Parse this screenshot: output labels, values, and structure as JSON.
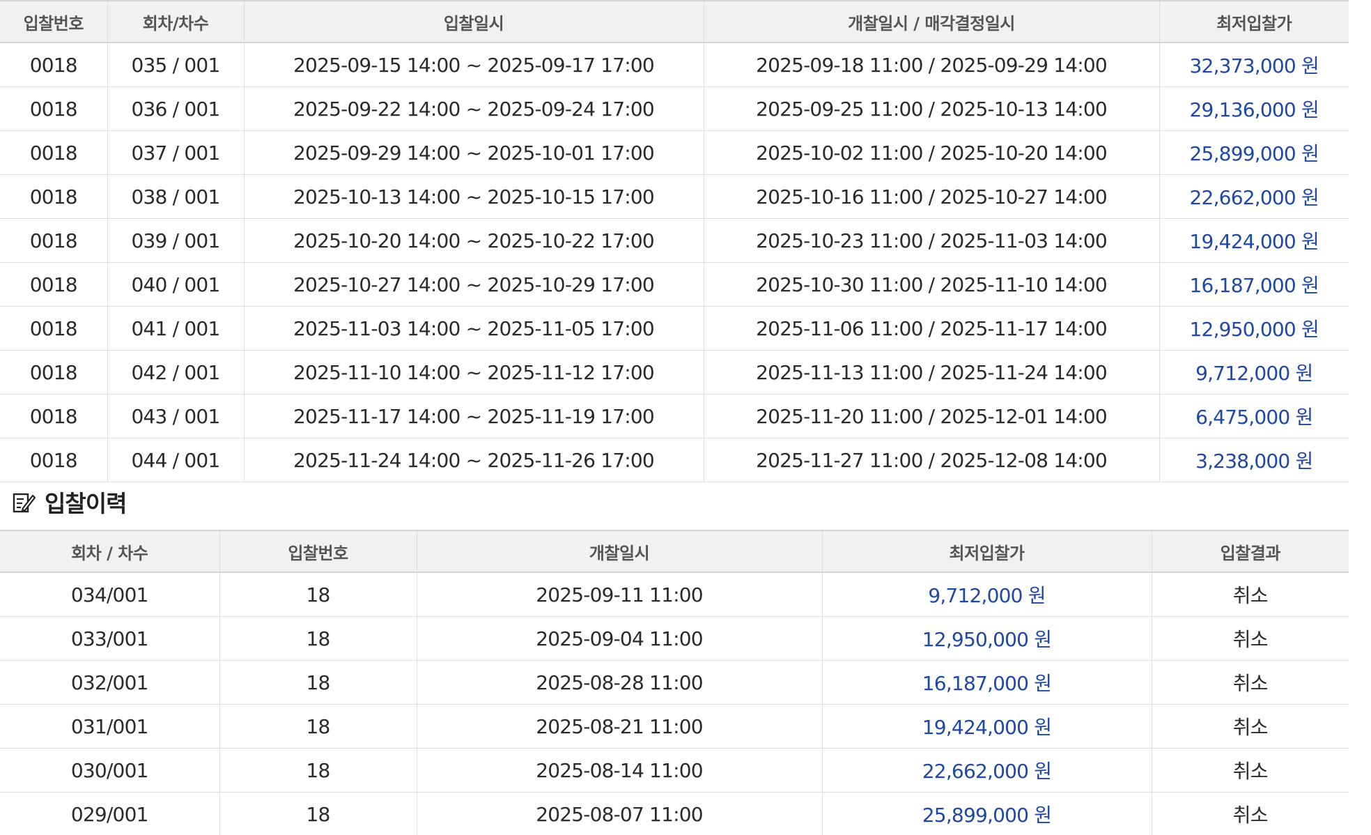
{
  "schedule": {
    "headers": [
      "입찰번호",
      "회차/차수",
      "입찰일시",
      "개찰일시 / 매각결정일시",
      "최저입찰가"
    ],
    "rows": [
      {
        "bid_no": "0018",
        "round": "035 / 001",
        "bid_period": "2025-09-15 14:00 ~ 2025-09-17 17:00",
        "open_decision": "2025-09-18 11:00 / 2025-09-29 14:00",
        "min_price": "32,373,000 원"
      },
      {
        "bid_no": "0018",
        "round": "036 / 001",
        "bid_period": "2025-09-22 14:00 ~ 2025-09-24 17:00",
        "open_decision": "2025-09-25 11:00 / 2025-10-13 14:00",
        "min_price": "29,136,000 원"
      },
      {
        "bid_no": "0018",
        "round": "037 / 001",
        "bid_period": "2025-09-29 14:00 ~ 2025-10-01 17:00",
        "open_decision": "2025-10-02 11:00 / 2025-10-20 14:00",
        "min_price": "25,899,000 원"
      },
      {
        "bid_no": "0018",
        "round": "038 / 001",
        "bid_period": "2025-10-13 14:00 ~ 2025-10-15 17:00",
        "open_decision": "2025-10-16 11:00 / 2025-10-27 14:00",
        "min_price": "22,662,000 원"
      },
      {
        "bid_no": "0018",
        "round": "039 / 001",
        "bid_period": "2025-10-20 14:00 ~ 2025-10-22 17:00",
        "open_decision": "2025-10-23 11:00 / 2025-11-03 14:00",
        "min_price": "19,424,000 원"
      },
      {
        "bid_no": "0018",
        "round": "040 / 001",
        "bid_period": "2025-10-27 14:00 ~ 2025-10-29 17:00",
        "open_decision": "2025-10-30 11:00 / 2025-11-10 14:00",
        "min_price": "16,187,000 원"
      },
      {
        "bid_no": "0018",
        "round": "041 / 001",
        "bid_period": "2025-11-03 14:00 ~ 2025-11-05 17:00",
        "open_decision": "2025-11-06 11:00 / 2025-11-17 14:00",
        "min_price": "12,950,000 원"
      },
      {
        "bid_no": "0018",
        "round": "042 / 001",
        "bid_period": "2025-11-10 14:00 ~ 2025-11-12 17:00",
        "open_decision": "2025-11-13 11:00 / 2025-11-24 14:00",
        "min_price": "9,712,000 원"
      },
      {
        "bid_no": "0018",
        "round": "043 / 001",
        "bid_period": "2025-11-17 14:00 ~ 2025-11-19 17:00",
        "open_decision": "2025-11-20 11:00 / 2025-12-01 14:00",
        "min_price": "6,475,000 원"
      },
      {
        "bid_no": "0018",
        "round": "044 / 001",
        "bid_period": "2025-11-24 14:00 ~ 2025-11-26 17:00",
        "open_decision": "2025-11-27 11:00 / 2025-12-08 14:00",
        "min_price": "3,238,000 원"
      }
    ]
  },
  "history": {
    "title": "입찰이력",
    "icon": "edit-note-icon",
    "headers": [
      "회차 / 차수",
      "입찰번호",
      "개찰일시",
      "최저입찰가",
      "입찰결과"
    ],
    "rows": [
      {
        "round": "034/001",
        "bid_no": "18",
        "open_date": "2025-09-11 11:00",
        "min_price": "9,712,000 원",
        "result": "취소"
      },
      {
        "round": "033/001",
        "bid_no": "18",
        "open_date": "2025-09-04 11:00",
        "min_price": "12,950,000 원",
        "result": "취소"
      },
      {
        "round": "032/001",
        "bid_no": "18",
        "open_date": "2025-08-28 11:00",
        "min_price": "16,187,000 원",
        "result": "취소"
      },
      {
        "round": "031/001",
        "bid_no": "18",
        "open_date": "2025-08-21 11:00",
        "min_price": "19,424,000 원",
        "result": "취소"
      },
      {
        "round": "030/001",
        "bid_no": "18",
        "open_date": "2025-08-14 11:00",
        "min_price": "22,662,000 원",
        "result": "취소"
      },
      {
        "round": "029/001",
        "bid_no": "18",
        "open_date": "2025-08-07 11:00",
        "min_price": "25,899,000 원",
        "result": "취소"
      }
    ]
  },
  "colors": {
    "price": "#1f47a8",
    "header_bg": "#f1f1f1",
    "border": "#dedede"
  }
}
